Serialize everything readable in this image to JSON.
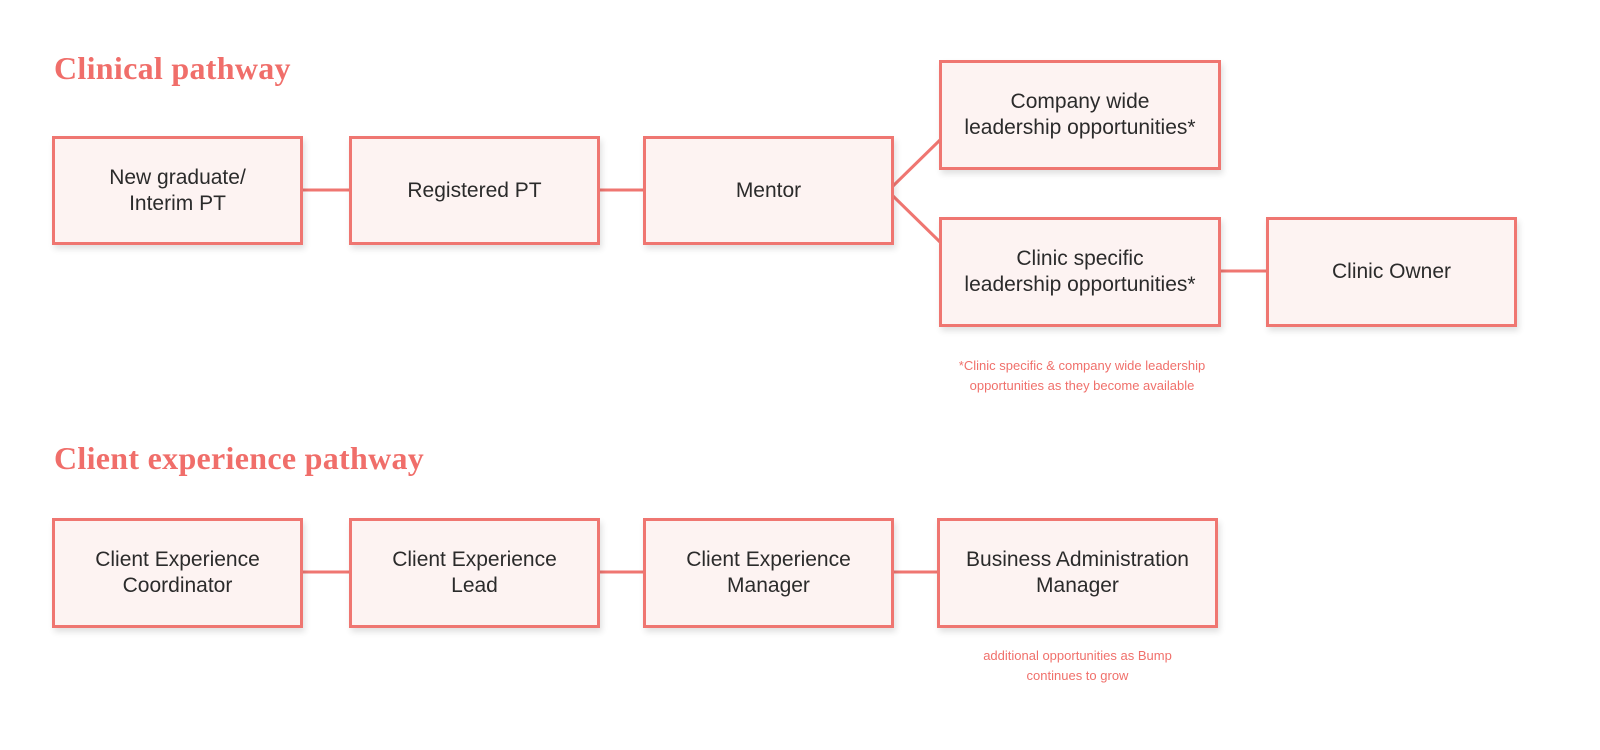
{
  "colors": {
    "accent": "#f06e6a",
    "box_fill": "#fdf3f2",
    "box_border": "#ef7671",
    "text": "#2b2b2b"
  },
  "clinical": {
    "title": "Clinical pathway",
    "nodes": [
      {
        "id": "new-grad",
        "label": "New graduate/\nInterim PT"
      },
      {
        "id": "registered-pt",
        "label": "Registered PT"
      },
      {
        "id": "mentor",
        "label": "Mentor"
      },
      {
        "id": "company-wide",
        "label": "Company wide\nleadership opportunities*"
      },
      {
        "id": "clinic-specific",
        "label": "Clinic specific\nleadership opportunities*"
      },
      {
        "id": "clinic-owner",
        "label": "Clinic Owner"
      }
    ],
    "edges": [
      [
        "new-grad",
        "registered-pt"
      ],
      [
        "registered-pt",
        "mentor"
      ],
      [
        "mentor",
        "company-wide"
      ],
      [
        "mentor",
        "clinic-specific"
      ],
      [
        "clinic-specific",
        "clinic-owner"
      ]
    ],
    "footnote": "*Clinic specific & company wide leadership\nopportunities as they become available"
  },
  "client": {
    "title": "Client experience pathway",
    "nodes": [
      {
        "id": "ce-coordinator",
        "label": "Client Experience\nCoordinator"
      },
      {
        "id": "ce-lead",
        "label": "Client Experience\nLead"
      },
      {
        "id": "ce-manager",
        "label": "Client Experience\nManager"
      },
      {
        "id": "ba-manager",
        "label": "Business Administration\nManager"
      }
    ],
    "edges": [
      [
        "ce-coordinator",
        "ce-lead"
      ],
      [
        "ce-lead",
        "ce-manager"
      ],
      [
        "ce-manager",
        "ba-manager"
      ]
    ],
    "footnote": "additional opportunities as Bump\ncontinues to grow"
  }
}
